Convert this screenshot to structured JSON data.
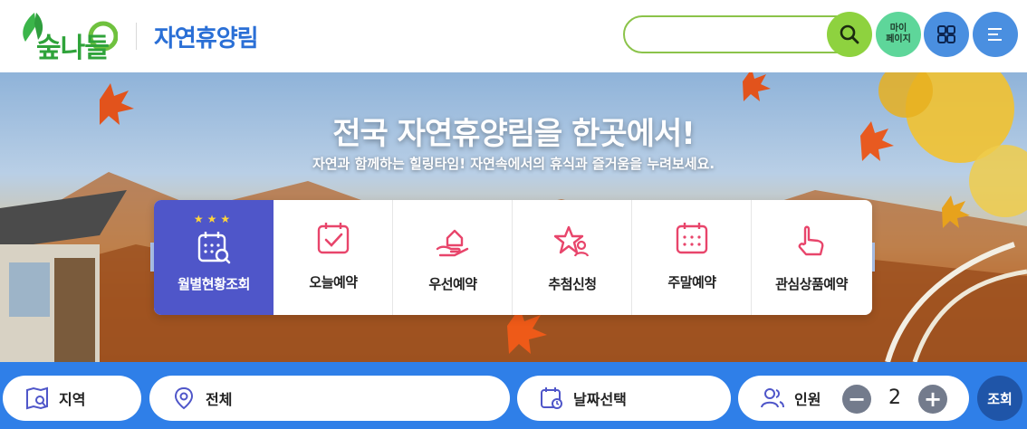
{
  "header": {
    "logo_text": "숲나들e",
    "site_name": "자연휴양림",
    "search": {
      "value": "",
      "placeholder": ""
    },
    "mypage_label_line1": "마이",
    "mypage_label_line2": "페이지"
  },
  "hero": {
    "title": "전국 자연휴양림을 한곳에서!",
    "subtitle": "자연과 함께하는 힐링타임! 자연속에서의 휴식과 즐거움을 누려보세요.",
    "menu": [
      {
        "label": "월별현황조회",
        "icon": "calendar-search-icon",
        "stars": "★★★",
        "active": true
      },
      {
        "label": "오늘예약",
        "icon": "calendar-check-icon"
      },
      {
        "label": "우선예약",
        "icon": "hand-house-icon"
      },
      {
        "label": "추첨신청",
        "icon": "star-person-icon"
      },
      {
        "label": "주말예약",
        "icon": "calendar-grid-icon"
      },
      {
        "label": "관심상품예약",
        "icon": "pointer-hand-icon"
      }
    ]
  },
  "search_bar": {
    "region_label": "지역",
    "area_label": "전체",
    "date_label": "날짜선택",
    "people_label": "인원",
    "people_count": "2",
    "minus": "−",
    "plus": "+",
    "submit_label": "조회"
  },
  "colors": {
    "brand_green": "#2fa33a",
    "brand_blue": "#2a6fd6",
    "active_menu": "#4f56c9",
    "search_bar_bg": "#2f7fe8",
    "icon_pink": "#e8456b"
  }
}
